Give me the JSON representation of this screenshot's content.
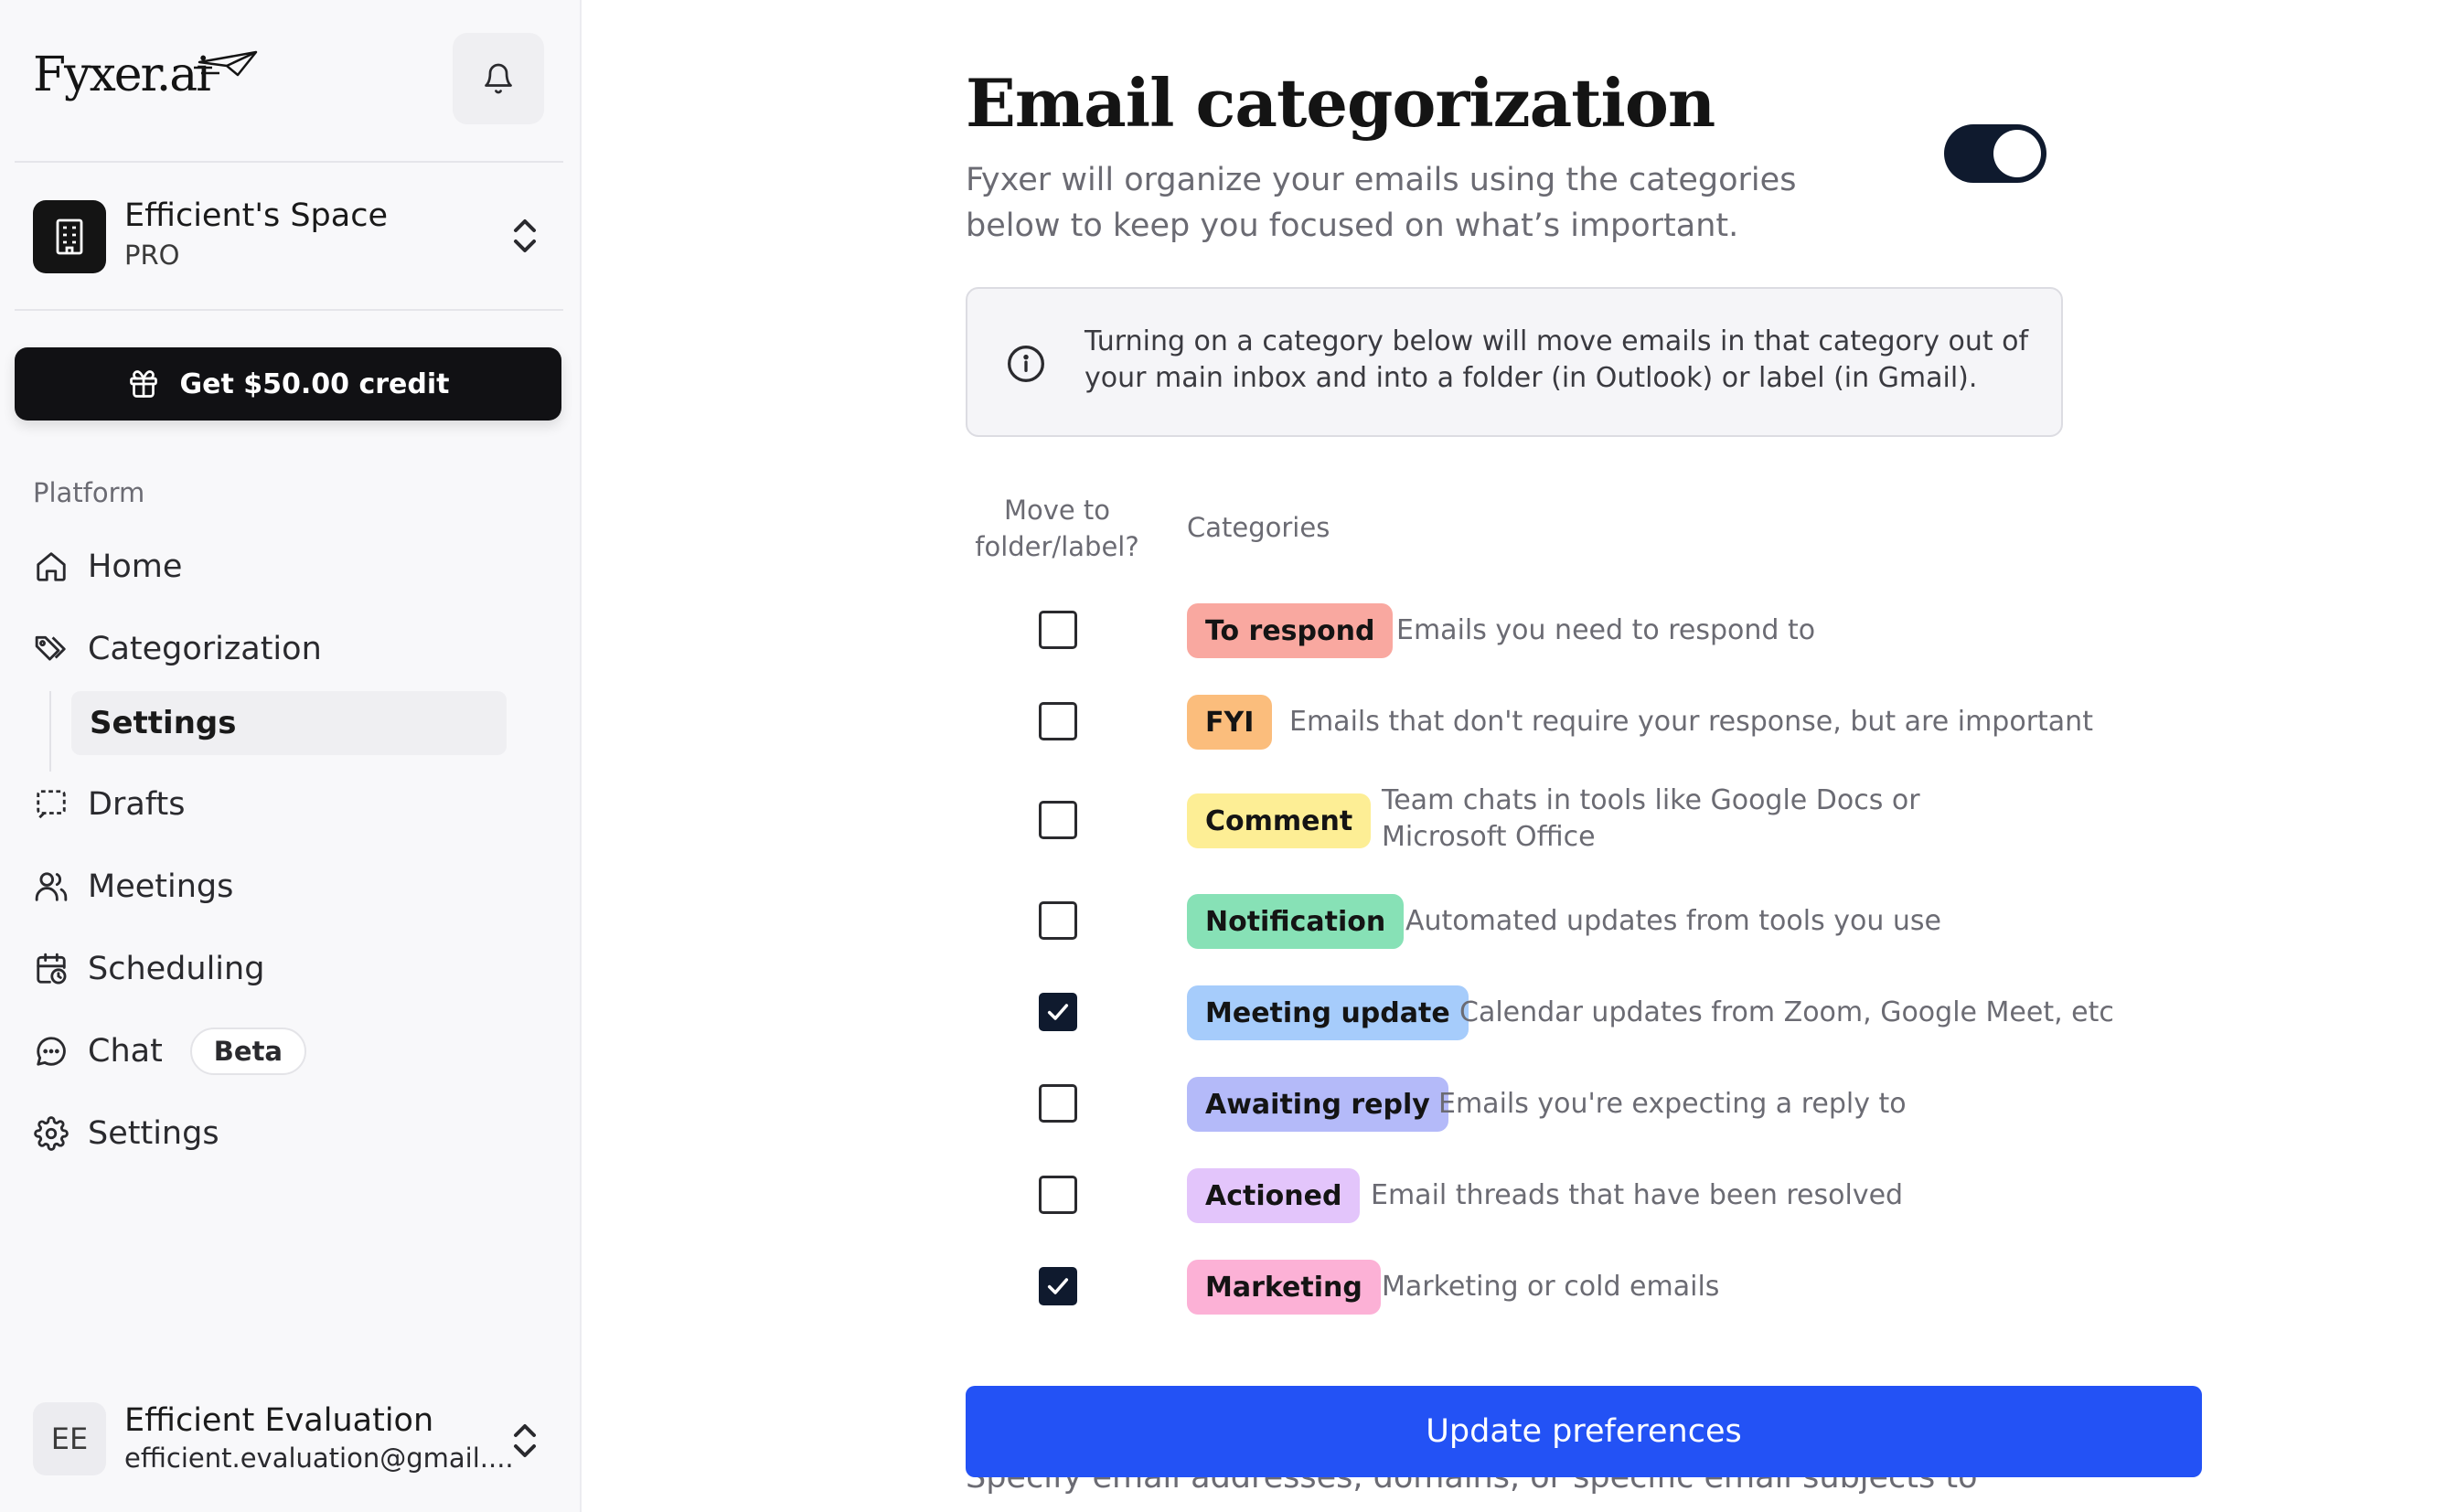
{
  "brand": {
    "name": "Fyxer.ai"
  },
  "workspace": {
    "name": "Efficient's Space",
    "plan": "PRO"
  },
  "credit_button": {
    "label": "Get $50.00 credit"
  },
  "sidebar": {
    "section_label": "Platform",
    "items": [
      {
        "label": "Home",
        "icon": "home-icon"
      },
      {
        "label": "Categorization",
        "icon": "tag-icon"
      },
      {
        "label": "Drafts",
        "icon": "drafts-icon"
      },
      {
        "label": "Meetings",
        "icon": "users-icon"
      },
      {
        "label": "Scheduling",
        "icon": "calendar-clock-icon"
      },
      {
        "label": "Chat",
        "icon": "chat-icon",
        "badge": "Beta"
      },
      {
        "label": "Settings",
        "icon": "gear-icon"
      }
    ],
    "sub_item": {
      "label": "Settings",
      "active": true
    }
  },
  "user": {
    "initials": "EE",
    "name": "Efficient Evaluation",
    "email": "efficient.evaluation@gmail...."
  },
  "main": {
    "title": "Email categorization",
    "subtitle": "Fyxer will organize your emails using the categories below to keep you focused on what’s important.",
    "toggle_on": true,
    "info": "Turning on a category below will move emails in that category out of your main inbox and into a folder (in Outlook) or label (in Gmail).",
    "col_move": "Move to folder/label?",
    "col_categories": "Categories",
    "categories": [
      {
        "label": "To respond",
        "desc": "Emails you need to respond to",
        "checked": false,
        "color": "#f9a8a0"
      },
      {
        "label": "FYI",
        "desc": "Emails that don't require your response, but are important",
        "checked": false,
        "color": "#fbbd7c"
      },
      {
        "label": "Comment",
        "desc": "Team chats in tools like Google Docs or Microsoft Office",
        "checked": false,
        "color": "#fdee95"
      },
      {
        "label": "Notification",
        "desc": "Automated updates from tools you use",
        "checked": false,
        "color": "#87e1b6"
      },
      {
        "label": "Meeting update",
        "desc": "Calendar updates from Zoom, Google Meet, etc",
        "checked": true,
        "color": "#a6ccfb"
      },
      {
        "label": "Awaiting reply",
        "desc": "Emails you're expecting a reply to",
        "checked": false,
        "color": "#b4baf9"
      },
      {
        "label": "Actioned",
        "desc": "Email threads that have been resolved",
        "checked": false,
        "color": "#e3c5fb"
      },
      {
        "label": "Marketing",
        "desc": "Marketing or cold emails",
        "checked": true,
        "color": "#fcb1d6"
      }
    ],
    "update_button": "Update preferences",
    "peek_text": "Specify email addresses, domains, or specific email subjects to"
  }
}
